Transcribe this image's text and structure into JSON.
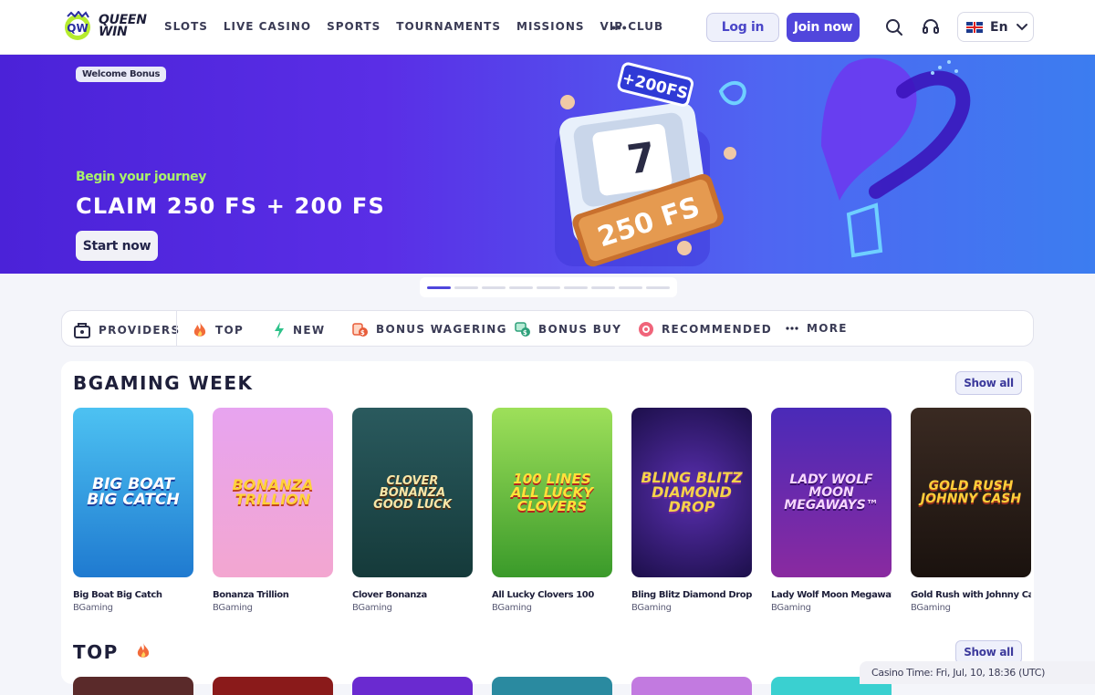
{
  "brand": {
    "line1": "QUEEN",
    "line2": "WIN"
  },
  "nav": {
    "items": [
      "SLOTS",
      "LIVE CASINO",
      "SPORTS",
      "TOURNAMENTS",
      "MISSIONS",
      "VIP CLUB"
    ],
    "more": "•••"
  },
  "header": {
    "login": "Log in",
    "join": "Join now",
    "language": "En"
  },
  "banner": {
    "badge": "Welcome Bonus",
    "subtitle": "Begin your journey",
    "title": "CLAIM 250 FS + 200 FS",
    "cta": "Start now",
    "art_top": "+200FS",
    "art_main": "250 FS",
    "art_seven": "7",
    "slides": 9,
    "active_slide": 1
  },
  "categories": [
    {
      "label": "PROVIDERS",
      "icon": "providers-icon"
    },
    {
      "label": "TOP",
      "icon": "fire-icon"
    },
    {
      "label": "NEW",
      "icon": "lightning-icon"
    },
    {
      "label": "BONUS WAGERING",
      "icon": "bonus-wagering-icon"
    },
    {
      "label": "BONUS BUY",
      "icon": "bonus-buy-icon"
    },
    {
      "label": "RECOMMENDED",
      "icon": "recommended-icon"
    },
    {
      "label": "MORE",
      "icon": "more-icon"
    }
  ],
  "section1": {
    "title": "BGAMING WEEK",
    "show_all": "Show all",
    "games": [
      {
        "name": "Big Boat Big Catch",
        "provider": "BGaming",
        "art": "BIG BOAT BIG CATCH"
      },
      {
        "name": "Bonanza Trillion",
        "provider": "BGaming",
        "art": "BONANZA TRILLION"
      },
      {
        "name": "Clover Bonanza",
        "provider": "BGaming",
        "art": "CLOVER BONANZA Good Luck"
      },
      {
        "name": "All Lucky Clovers 100",
        "provider": "BGaming",
        "art": "100 LINES ALL LUCKY CLOVERS"
      },
      {
        "name": "Bling Blitz Diamond Drop",
        "provider": "BGaming",
        "art": "BLING BLITZ Diamond Drop"
      },
      {
        "name": "Lady Wolf Moon Megaways",
        "provider": "BGaming",
        "art": "Lady Wolf Moon MEGAWAYS™"
      },
      {
        "name": "Gold Rush with Johnny Cash",
        "provider": "BGaming",
        "art": "GOLD RUSH JOHNNY CASH"
      }
    ]
  },
  "section2": {
    "title": "TOP",
    "show_all": "Show all"
  },
  "casino_time": "Casino Time: Fri, Jul, 10, 18:36 (UTC)"
}
